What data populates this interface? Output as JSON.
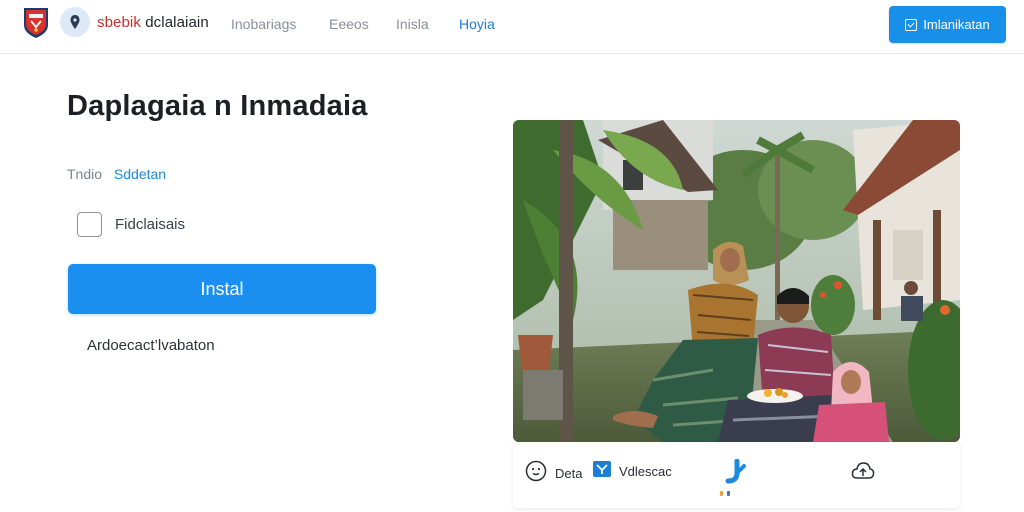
{
  "header": {
    "brand_part1": "sbebik",
    "brand_part2": " dclalaiain",
    "nav": [
      {
        "label": "Inobariags",
        "active": false
      },
      {
        "label": "Eeeos",
        "active": false
      },
      {
        "label": "Inisla",
        "active": false
      },
      {
        "label": "Hoyia",
        "active": true
      }
    ],
    "action_label": "Imlanikatan"
  },
  "main": {
    "title": "Daplagaia n Inmadaia",
    "meta_label": "Tndio",
    "meta_link": "Sddetan",
    "checkbox_label": "Fidclaisais",
    "primary_button": "Instal",
    "sub_link": "Ardoecact’lvabaton"
  },
  "media_bar": {
    "item1_label": "Deta",
    "item2_label": "Vdlescac"
  },
  "colors": {
    "accent": "#1a8ff0",
    "brand_red": "#c9302c",
    "link": "#1a8be0"
  },
  "icons": [
    "shield-logo-icon",
    "location-pin-icon",
    "checkbox-icon",
    "smile-icon",
    "flag-icon",
    "play-icon",
    "cloud-upload-icon"
  ]
}
